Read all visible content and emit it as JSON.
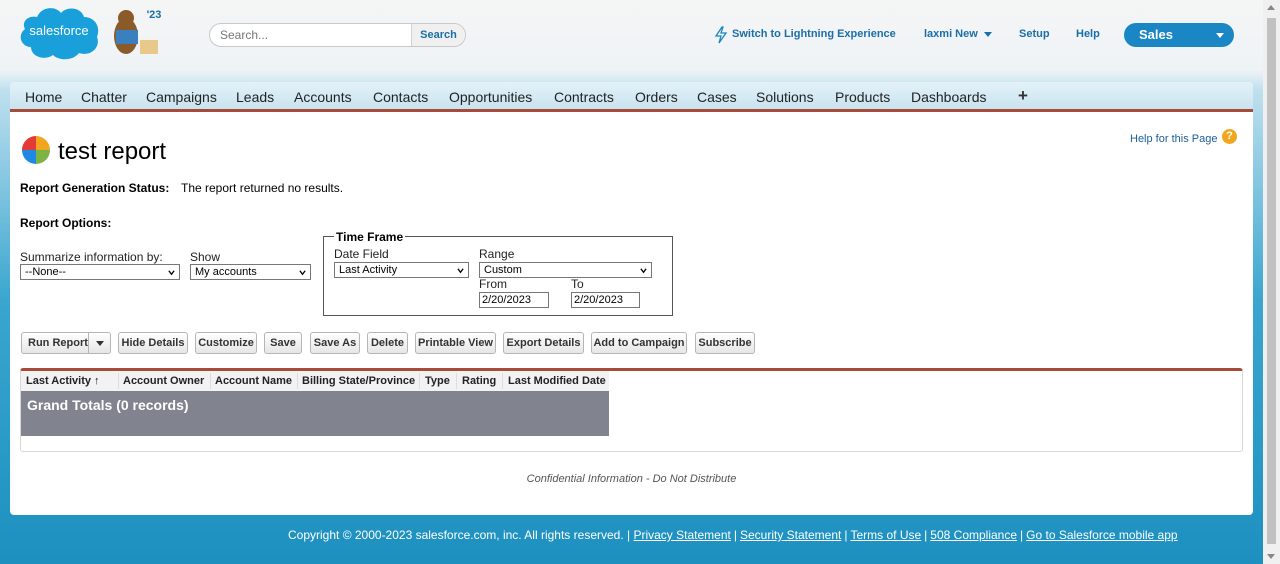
{
  "header": {
    "logo_text": "salesforce",
    "mascot_badge": "'23",
    "search": {
      "placeholder": "Search...",
      "button_label": "Search"
    },
    "switch_lightning": "Switch to Lightning Experience",
    "user_menu": "laxmi New",
    "setup": "Setup",
    "help": "Help",
    "app_switcher": "Sales"
  },
  "tabs": [
    "Home",
    "Chatter",
    "Campaigns",
    "Leads",
    "Accounts",
    "Contacts",
    "Opportunities",
    "Contracts",
    "Orders",
    "Cases",
    "Solutions",
    "Products",
    "Dashboards"
  ],
  "plus_tab": "+",
  "report": {
    "title": "test report",
    "help_link": "Help for this Page",
    "status_label": "Report Generation Status:",
    "status_value": "The report returned no results.",
    "options_label": "Report Options:",
    "summarize_label": "Summarize information by:",
    "summarize_value": "--None--",
    "show_label": "Show",
    "show_value": "My accounts",
    "timeframe": {
      "legend": "Time Frame",
      "date_field_label": "Date Field",
      "date_field_value": "Last Activity",
      "range_label": "Range",
      "range_value": "Custom",
      "from_label": "From",
      "from_value": "2/20/2023",
      "to_label": "To",
      "to_value": "2/20/2023"
    }
  },
  "buttons": {
    "run_report": "Run Report",
    "hide_details": "Hide Details",
    "customize": "Customize",
    "save": "Save",
    "save_as": "Save As",
    "delete": "Delete",
    "printable_view": "Printable View",
    "export_details": "Export Details",
    "add_to_campaign": "Add to Campaign",
    "subscribe": "Subscribe"
  },
  "table": {
    "columns": [
      "Last Activity ↑",
      "Account Owner",
      "Account Name",
      "Billing State/Province",
      "Type",
      "Rating",
      "Last Modified Date"
    ],
    "grand_totals": "Grand Totals (0 records)"
  },
  "confidential": "Confidential Information - Do Not Distribute",
  "footer": {
    "copyright": "Copyright © 2000-2023 salesforce.com, inc. All rights reserved. |",
    "links": [
      "Privacy Statement",
      "Security Statement",
      "Terms of Use",
      "508 Compliance",
      "Go to Salesforce mobile app"
    ],
    "separator": "|"
  },
  "colors": {
    "brand_blue": "#1a86c4",
    "tab_underline": "#a64b3a",
    "grand_total_bg": "#81848f",
    "help_icon": "#f2a61f"
  }
}
